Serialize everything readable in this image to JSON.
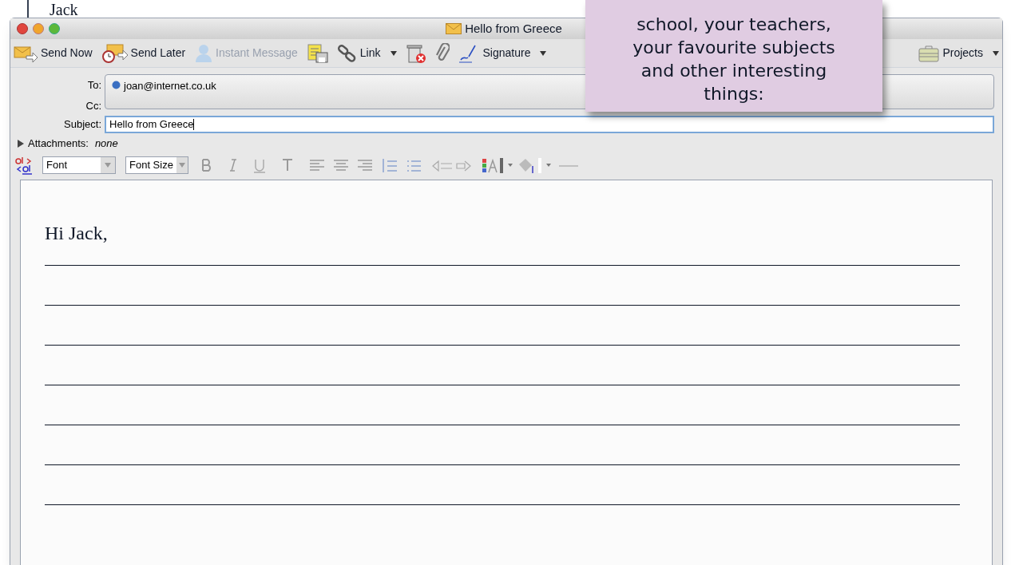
{
  "page_text": "Jack",
  "window": {
    "title": "Hello from Greece"
  },
  "toolbar": [
    {
      "kind": "button",
      "label": "Send Now",
      "disabled": false
    },
    {
      "kind": "button",
      "label": "Send Later",
      "disabled": false
    },
    {
      "kind": "button",
      "label": "Instant Message",
      "disabled": true
    },
    {
      "kind": "icon"
    },
    {
      "kind": "menu",
      "label": "Link",
      "disabled": false
    },
    {
      "kind": "icon"
    },
    {
      "kind": "icon"
    },
    {
      "kind": "menu",
      "label": "Signature",
      "disabled": false
    },
    {
      "kind": "spacer"
    },
    {
      "kind": "menu",
      "label": "Projects",
      "disabled": false
    }
  ],
  "to": {
    "label": "To:",
    "value": "joan@internet.co.uk"
  },
  "cc": {
    "label": "Cc:"
  },
  "subject": {
    "label": "Subject:",
    "value": "Hello from Greece"
  },
  "attachments": {
    "label": "Attachments:",
    "value": "none"
  },
  "format_bar": {
    "font": "Font",
    "font_size": "Font Size"
  },
  "body": {
    "greeting": "Hi Jack,"
  },
  "note": {
    "lines": [
      "school, your teachers,",
      "your favourite subjects",
      "and other interesting",
      "things:"
    ]
  }
}
